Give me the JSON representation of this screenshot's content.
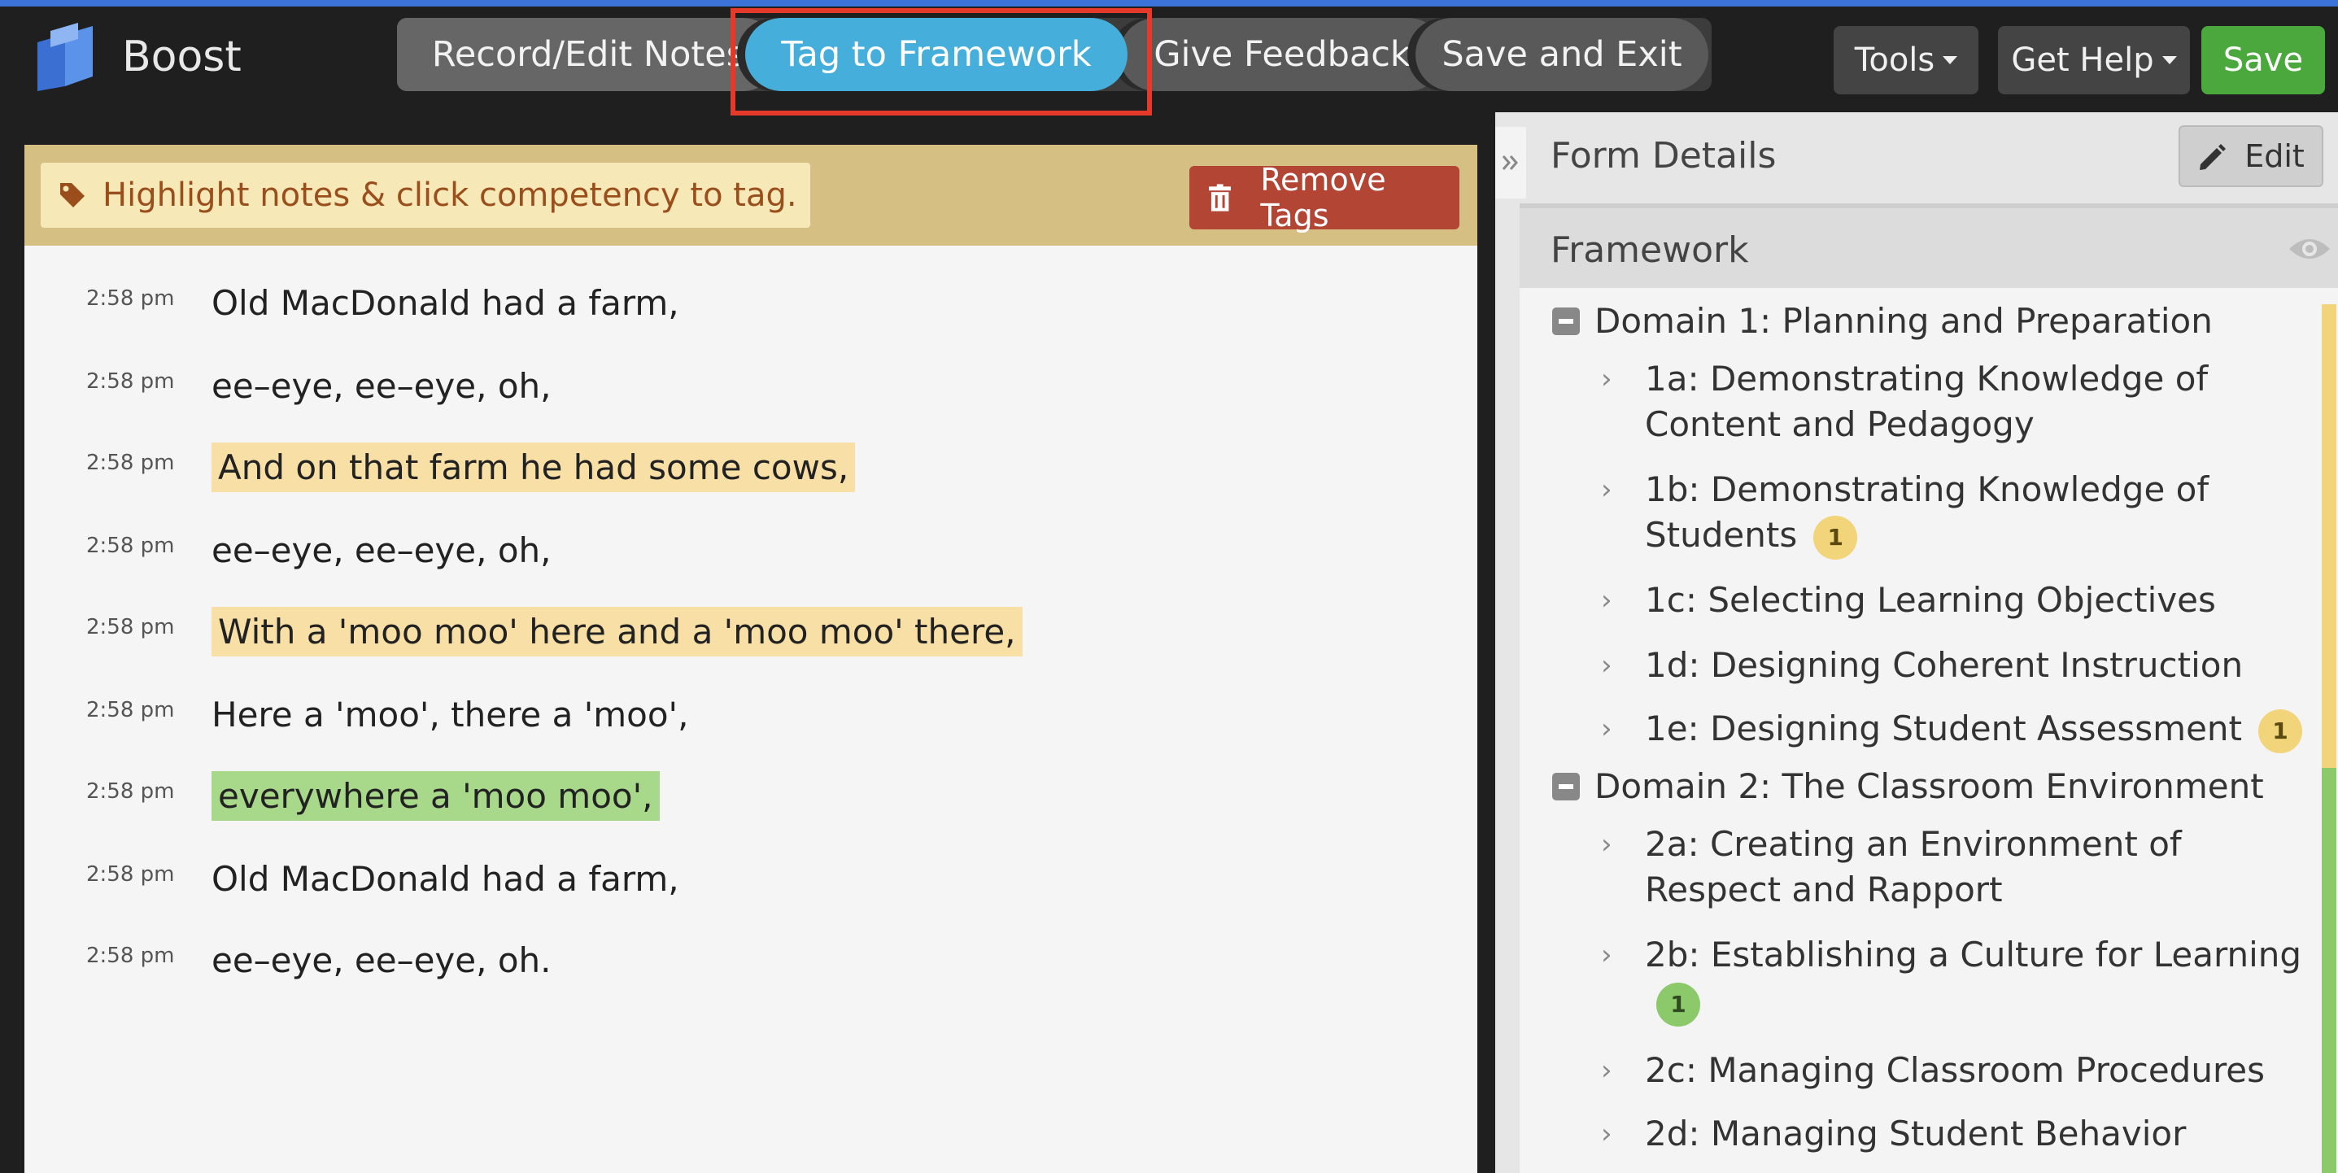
{
  "app": {
    "name": "Boost"
  },
  "nav": {
    "record": "Record/Edit Notes",
    "tag": "Tag to Framework",
    "feedback": "Give Feedback",
    "save_exit": "Save and Exit",
    "tools": "Tools",
    "help": "Get Help",
    "save": "Save"
  },
  "tagbar": {
    "hint": "Highlight notes & click competency to tag.",
    "remove": "Remove Tags"
  },
  "notes": [
    {
      "time": "2:58 pm",
      "text": "Old MacDonald had a farm,"
    },
    {
      "time": "2:58 pm",
      "text": "ee–eye, ee–eye, oh,"
    },
    {
      "time": "2:58 pm",
      "text": "And on that farm he had some cows,",
      "highlight": "yellow"
    },
    {
      "time": "2:58 pm",
      "text": "ee–eye, ee–eye, oh,"
    },
    {
      "time": "2:58 pm",
      "text": "With a 'moo moo' here and a 'moo moo' there,",
      "highlight": "yellow"
    },
    {
      "time": "2:58 pm",
      "text": "Here a 'moo', there a 'moo',"
    },
    {
      "time": "2:58 pm",
      "text": "everywhere a 'moo moo',",
      "highlight": "green"
    },
    {
      "time": "2:58 pm",
      "text": "Old MacDonald had a farm,"
    },
    {
      "time": "2:58 pm",
      "text": "ee–eye, ee–eye, oh."
    }
  ],
  "form_details": {
    "title": "Form Details",
    "edit": "Edit"
  },
  "framework": {
    "title": "Framework",
    "domains": [
      {
        "label": "Domain 1: Planning and Preparation",
        "competencies": [
          {
            "label": "1a: Demonstrating Knowledge of Content and Pedagogy"
          },
          {
            "label": "1b: Demonstrating Knowledge of Students",
            "count": "1"
          },
          {
            "label": "1c: Selecting Learning Objectives"
          },
          {
            "label": "1d: Designing Coherent Instruction"
          },
          {
            "label": "1e: Designing Student Assessment",
            "count": "1"
          }
        ]
      },
      {
        "label": "Domain 2: The Classroom Environment",
        "competencies": [
          {
            "label": "2a: Creating an Environment of Respect and Rapport"
          },
          {
            "label": "2b: Establishing a Culture for Learning",
            "count": "1"
          },
          {
            "label": "2c: Managing Classroom Procedures"
          },
          {
            "label": "2d: Managing Student Behavior"
          }
        ]
      }
    ]
  },
  "colors": {
    "accent": "#45aedb",
    "save": "#4aa83c",
    "highlight_yellow": "#f7dfa6",
    "highlight_green": "#a8d88a",
    "remove": "#b34535"
  }
}
